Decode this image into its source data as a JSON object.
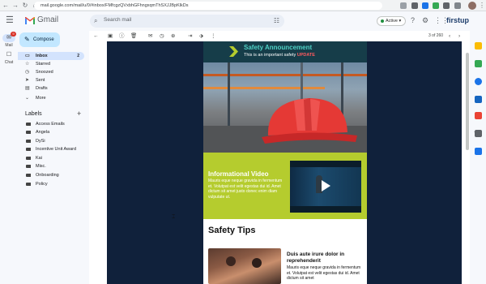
{
  "browser": {
    "url": "mail.google.com/mail/u/0/#inbox/FMfcgzQVxbhGFhngxqmThSXJJBpKlkDs"
  },
  "header": {
    "app_name": "Gmail",
    "search_placeholder": "Search mail",
    "status_label": "Active",
    "org_logo_text": "firstup"
  },
  "rail": {
    "mail_label": "Mail",
    "mail_badge": "9",
    "chat_label": "Chat"
  },
  "sidebar": {
    "compose_label": "Compose",
    "nav": [
      {
        "label": "Inbox",
        "count": "2"
      },
      {
        "label": "Starred"
      },
      {
        "label": "Snoozed"
      },
      {
        "label": "Sent"
      },
      {
        "label": "Drafts"
      },
      {
        "label": "More"
      }
    ],
    "labels_heading": "Labels",
    "labels": [
      "Access Emails",
      "Angela",
      "DySi",
      "Incentive Unit Award",
      "Kai",
      "Misc.",
      "Onboarding",
      "Policy"
    ]
  },
  "toolbar": {
    "pagination": "3 of 260"
  },
  "email": {
    "banner_title": "Safety Announcement",
    "banner_sub_prefix": "This is an important safety ",
    "banner_sub_highlight": "UPDATE",
    "video_title": "Informational Video",
    "video_body": "Mauris eque neque gravida in fermentum et. Volutpat est velit egestas dui id. Amet dictum sit amet justo donec enim diam vulputate ut.",
    "tips_title": "Safety Tips",
    "tips_heading": "Duis aute irure dolor in reprehenderit",
    "tips_body": "Mauris eque neque gravida in fermentum et. Volutpat est velit egestas dui id. Amet dictum sit amet"
  },
  "colors": {
    "banner_bg": "#163d49",
    "banner_title": "#4fd1c5",
    "banner_highlight": "#ff5a5f",
    "video_section_bg": "#b5cc2e",
    "email_backdrop": "#10213b",
    "helmet": "#e53935"
  }
}
